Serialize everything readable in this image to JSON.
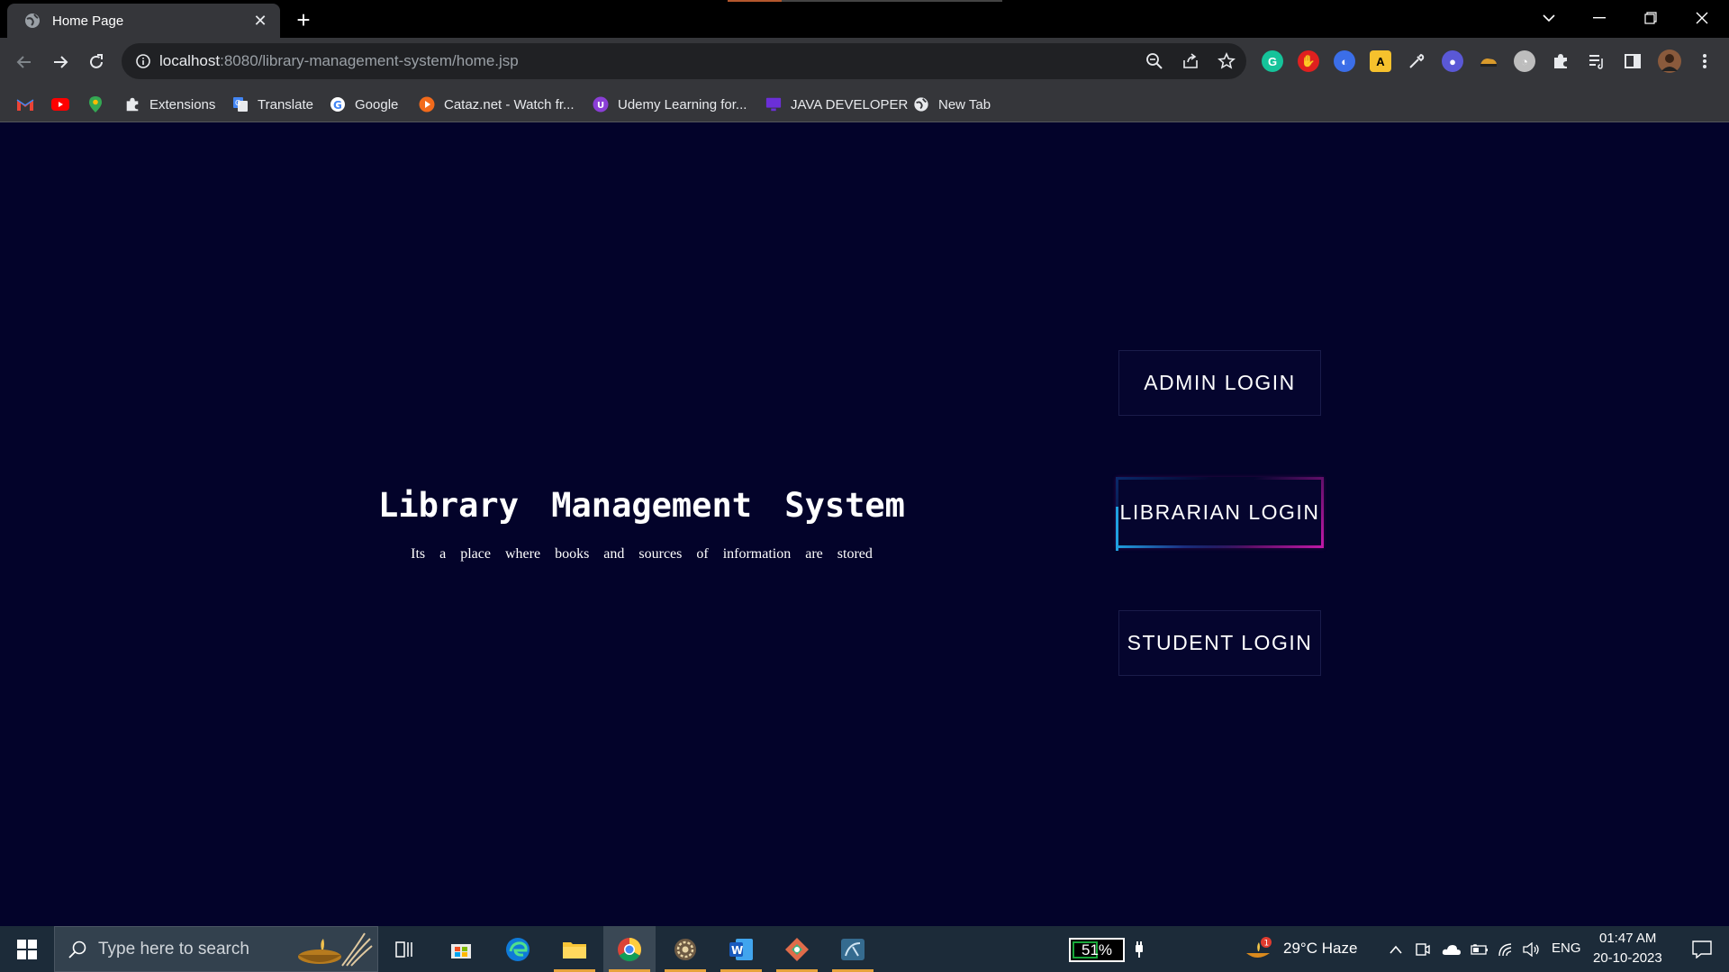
{
  "browser": {
    "tab_title": "Home Page",
    "tab_close": "✕",
    "new_tab": "+",
    "url_host": "localhost",
    "url_path": ":8080/library-management-system/home.jsp",
    "bookmarks": [
      {
        "label": "Extensions"
      },
      {
        "label": "Translate"
      },
      {
        "label": "Google"
      },
      {
        "label": "Cataz.net - Watch fr..."
      },
      {
        "label": "Udemy Learning for..."
      },
      {
        "label": "JAVA DEVELOPER"
      },
      {
        "label": "New Tab"
      }
    ]
  },
  "page": {
    "title": "Library Management System",
    "subtitle": "Its a place where books and sources of information are stored",
    "buttons": {
      "admin": "ADMIN LOGIN",
      "librarian": "LIBRARIAN LOGIN",
      "student": "STUDENT LOGIN"
    }
  },
  "taskbar": {
    "search_placeholder": "Type here to search",
    "battery": "51%",
    "weather": "29°C  Haze",
    "weather_badge": "1",
    "language": "ENG",
    "time": "01:47 AM",
    "date": "20-10-2023"
  }
}
